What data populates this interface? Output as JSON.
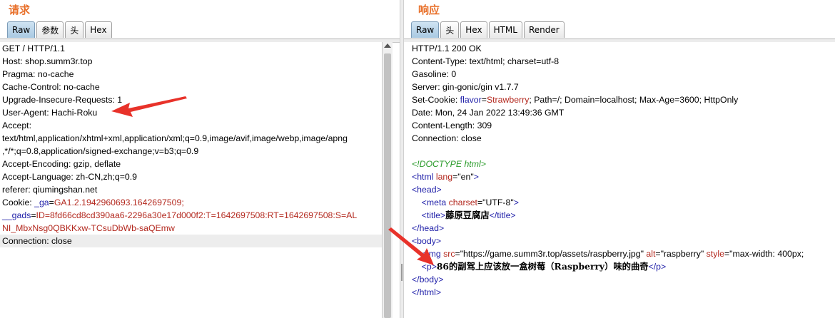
{
  "request": {
    "title": "请求",
    "tabs": [
      "Raw",
      "参数",
      "头",
      "Hex"
    ],
    "lines": {
      "l0": "GET / HTTP/1.1",
      "l1": "Host: shop.summ3r.top",
      "l2": "Pragma: no-cache",
      "l3": "Cache-Control: no-cache",
      "l4": "Upgrade-Insecure-Requests: 1",
      "l5": "User-Agent: Hachi-Roku",
      "l6": "Accept:",
      "l7": "text/html,application/xhtml+xml,application/xml;q=0.9,image/avif,image/webp,image/apng",
      "l8": ",*/*;q=0.8,application/signed-exchange;v=b3;q=0.9",
      "l9": "Accept-Encoding: gzip, deflate",
      "l10": "Accept-Language: zh-CN,zh;q=0.9",
      "l11": "referer: qiumingshan.net",
      "l12_prefix": "Cookie: ",
      "l12_name": "_ga",
      "l12_eq": "=",
      "l12_value": "GA1.2.1942960693.1642697509;",
      "l13_name": "__gads",
      "l13_eq": "=",
      "l13_value": "ID=8fd66cd8cd390aa6-2296a30e17d000f2:T=1642697508:RT=1642697508:S=AL",
      "l14_value": "NI_MbxNsg0QBKKxw-TCsuDbWb-saQEmw",
      "l15": "Connection: close"
    }
  },
  "response": {
    "title": "响应",
    "tabs": [
      "Raw",
      "头",
      "Hex",
      "HTML",
      "Render"
    ],
    "lines": {
      "h0": "HTTP/1.1 200 OK",
      "h1": "Content-Type: text/html; charset=utf-8",
      "h2": "Gasoline: 0",
      "h3": "Server: gin-gonic/gin v1.7.7",
      "h4_prefix": "Set-Cookie: ",
      "h4_name": "flavor",
      "h4_eq": "=",
      "h4_value": "Strawberry",
      "h4_suffix": "; Path=/; Domain=localhost; Max-Age=3600; HttpOnly",
      "h5": "Date: Mon, 24 Jan 2022 13:49:36 GMT",
      "h6": "Content-Length: 309",
      "h7": "Connection: close",
      "b0": "<!DOCTYPE html>",
      "b1_open": "<",
      "b1_tag": "html",
      "b1_attr": " lang",
      "b1_eq": "=",
      "b1_val": "\"en\"",
      "b1_close": ">",
      "b2": "<head>",
      "b3_indent": "    ",
      "b3_open": "<",
      "b3_tag": "meta",
      "b3_attr": " charset",
      "b3_eq": "=",
      "b3_val": "\"UTF-8\"",
      "b3_close": ">",
      "b4_indent": "    ",
      "b4_open": "<title>",
      "b4_text": "藤原豆腐店",
      "b4_close": "</title>",
      "b5": "</head>",
      "b6": "<body>",
      "b7_indent": "    ",
      "b7_open": "<",
      "b7_tag": "img",
      "b7_a1": " src",
      "b7_eq1": "=",
      "b7_v1": "\"https://game.summ3r.top/assets/raspberry.jpg\"",
      "b7_a2": " alt",
      "b7_eq2": "=",
      "b7_v2": "\"raspberry\"",
      "b7_a3": " style",
      "b7_eq3": "=",
      "b7_v3": "\"max-width: 400px;",
      "b8_indent": "    ",
      "b8_open": "<p>",
      "b8_text": "86的副驾上应该放一盒树莓（Raspberry）味的曲奇",
      "b8_close": "</p>",
      "b9": "</body>",
      "b10": "</html>"
    }
  },
  "colors": {
    "title": "#e8702a",
    "keyword": "#1e1ea8",
    "value": "#b3281e",
    "doctype": "#2a9b2a",
    "annotation_arrow": "#e8322a"
  }
}
